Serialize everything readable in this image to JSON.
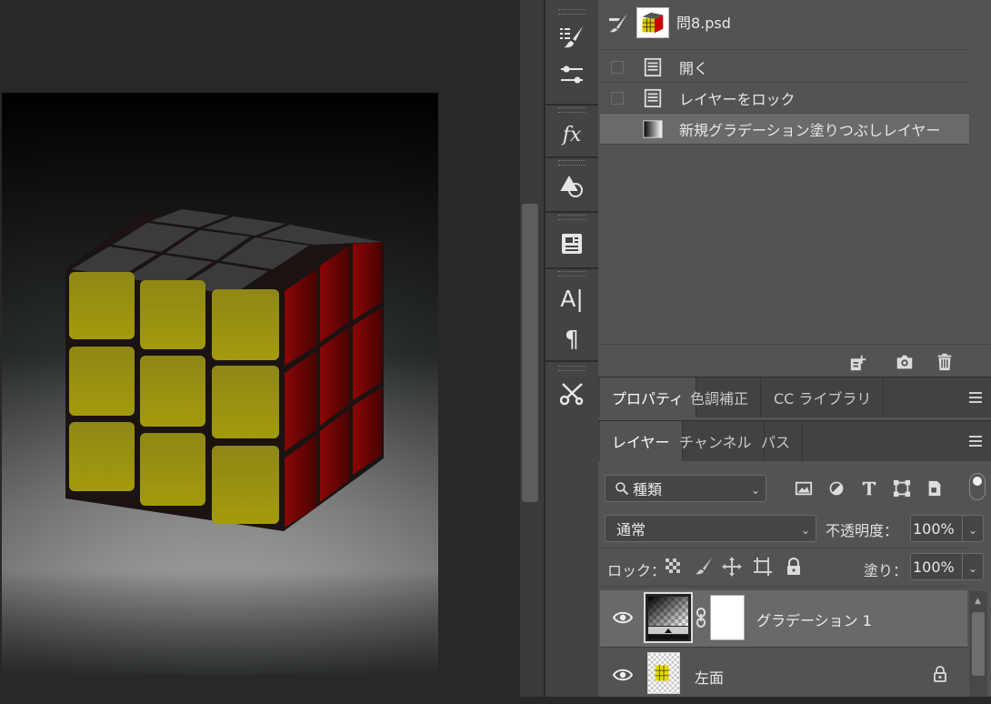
{
  "history": {
    "snapshot_name": "問8.psd",
    "items": [
      {
        "label": "開く"
      },
      {
        "label": "レイヤーをロック"
      },
      {
        "label": "新規グラデーション塗りつぶしレイヤー"
      }
    ]
  },
  "properties_tabs": {
    "tabs": [
      "プロパティ",
      "色調補正",
      "CC ライブラリ"
    ]
  },
  "layers_tabs": {
    "tabs": [
      "レイヤー",
      "チャンネル",
      "パス"
    ]
  },
  "filter": {
    "kind": "種類"
  },
  "blend": {
    "mode": "通常",
    "opacity_label": "不透明度：",
    "opacity_value": "100%"
  },
  "lock": {
    "label": "ロック：",
    "fill_label": "塗り：",
    "fill_value": "100%"
  },
  "layers": [
    {
      "name": "グラデーション 1",
      "visible": true,
      "selected": true
    },
    {
      "name": "左面",
      "visible": true,
      "locked": true
    }
  ],
  "toolstrip": {
    "text_tool_glyph": "A|",
    "paragraph_glyph": "¶",
    "fx_glyph": "fx"
  },
  "colors": {
    "panel_bg": "#535353",
    "selected_row": "#696969",
    "cube_yellow": "#9c9512",
    "cube_red": "#7a0303"
  }
}
